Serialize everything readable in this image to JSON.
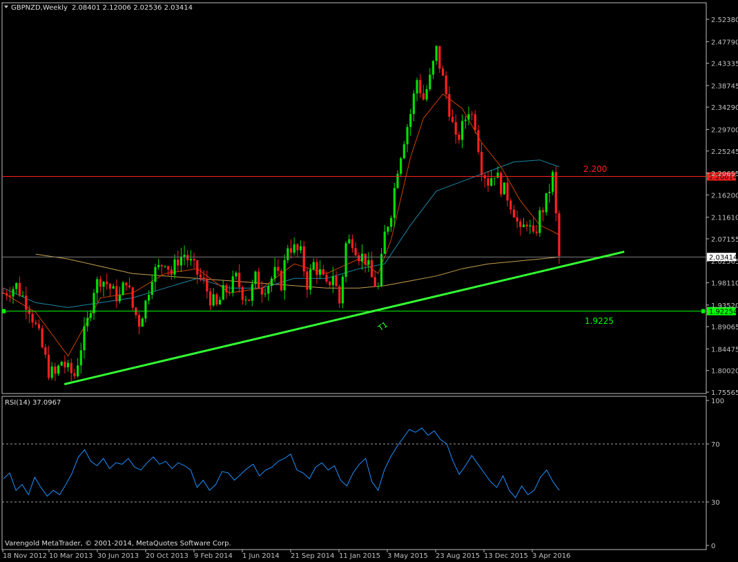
{
  "window": {
    "symbol_title": "GBPNZD,Weekly",
    "ohlc_readout": "2.08401 2.12006 2.02536 2.03414",
    "menu_icon": "triangle-down-icon",
    "copyright": "Varengold MetaTrader, © 2001-2014, MetaQuotes Software Corp."
  },
  "colors": {
    "background": "#000000",
    "bull": "#00e000",
    "bear": "#ff2020",
    "rsi": "#1e90ff",
    "ma_fast": "#cc4400",
    "ma_mid": "#1e88a8",
    "ma_slow": "#c8a050",
    "resistance": "#ff2020",
    "support": "#00ff00",
    "trendline": "#33ff33",
    "axis": "#c0c0c0"
  },
  "annotations": {
    "resistance_label": "2.200",
    "support_label": "1.9225",
    "trendline_label": "T1"
  },
  "chart_data": [
    {
      "type": "candlestick",
      "title": "GBPNZD,Weekly",
      "ylim": [
        1.75565,
        2.54
      ],
      "y_ticks": [
        "2.52380",
        "2.47790",
        "2.43335",
        "2.38745",
        "2.34290",
        "2.29700",
        "2.25245",
        "2.20655",
        "2.16200",
        "2.11610",
        "2.07155",
        "2.02565",
        "1.98110",
        "1.93520",
        "1.89065",
        "1.84475",
        "1.80020",
        "1.75565"
      ],
      "x_ticks": [
        "18 Nov 2012",
        "10 Mar 2013",
        "30 Jun 2013",
        "20 Oct 2013",
        "9 Feb 2014",
        "1 Jun 2014",
        "21 Sep 2014",
        "11 Jan 2015",
        "3 May 2015",
        "23 Aug 2015",
        "13 Dec 2015",
        "3 Apr 2016"
      ],
      "price_markers": [
        {
          "label": "2.20014",
          "value": 2.20014,
          "color": "#ff2020"
        },
        {
          "label": "2.03414",
          "value": 2.03414,
          "color": "#ffffff"
        },
        {
          "label": "1.92254",
          "value": 1.92254,
          "color": "#00ff00"
        }
      ],
      "horizontal_lines": [
        {
          "value": 2.20014,
          "color": "#ff2020",
          "label": "2.200"
        },
        {
          "value": 1.92254,
          "color": "#00ff00",
          "label": "1.9225"
        },
        {
          "value": 2.03414,
          "color": "#808080",
          "label": ""
        }
      ],
      "trendline": {
        "label": "T1",
        "start": {
          "week": 15,
          "price": 1.772
        },
        "end": {
          "week": 190,
          "price": 2.045
        }
      },
      "close_path": [
        [
          0,
          1.96
        ],
        [
          4,
          1.975
        ],
        [
          8,
          1.93
        ],
        [
          11,
          1.87
        ],
        [
          14,
          1.8
        ],
        [
          16,
          1.79
        ],
        [
          18,
          1.82
        ],
        [
          20,
          1.8
        ],
        [
          22,
          1.79
        ],
        [
          24,
          1.85
        ],
        [
          26,
          1.9
        ],
        [
          28,
          1.97
        ],
        [
          30,
          1.99
        ],
        [
          32,
          1.98
        ],
        [
          34,
          1.96
        ],
        [
          36,
          1.95
        ],
        [
          38,
          1.99
        ],
        [
          40,
          1.93
        ],
        [
          42,
          1.9
        ],
        [
          44,
          1.94
        ],
        [
          46,
          2.0
        ],
        [
          48,
          2.01
        ],
        [
          50,
          2.03
        ],
        [
          52,
          2.0
        ],
        [
          54,
          2.03
        ],
        [
          56,
          2.04
        ],
        [
          58,
          2.02
        ],
        [
          60,
          2.0
        ],
        [
          62,
          1.98
        ],
        [
          64,
          1.95
        ],
        [
          66,
          1.93
        ],
        [
          68,
          1.96
        ],
        [
          70,
          1.97
        ],
        [
          72,
          1.99
        ],
        [
          74,
          1.96
        ],
        [
          76,
          1.95
        ],
        [
          78,
          1.99
        ],
        [
          80,
          1.97
        ],
        [
          82,
          1.98
        ],
        [
          84,
          2.0
        ],
        [
          86,
          1.98
        ],
        [
          88,
          2.06
        ],
        [
          90,
          2.05
        ],
        [
          92,
          2.04
        ],
        [
          94,
          1.98
        ],
        [
          96,
          2.02
        ],
        [
          98,
          2.0
        ],
        [
          100,
          1.97
        ],
        [
          102,
          2.0
        ],
        [
          104,
          1.94
        ],
        [
          106,
          2.06
        ],
        [
          108,
          2.07
        ],
        [
          110,
          2.04
        ],
        [
          112,
          2.03
        ],
        [
          114,
          1.99
        ],
        [
          116,
          1.97
        ],
        [
          118,
          2.08
        ],
        [
          120,
          2.13
        ],
        [
          122,
          2.22
        ],
        [
          124,
          2.28
        ],
        [
          126,
          2.33
        ],
        [
          128,
          2.4
        ],
        [
          130,
          2.36
        ],
        [
          132,
          2.4
        ],
        [
          134,
          2.46
        ],
        [
          136,
          2.4
        ],
        [
          138,
          2.34
        ],
        [
          140,
          2.27
        ],
        [
          142,
          2.3
        ],
        [
          144,
          2.34
        ],
        [
          146,
          2.31
        ],
        [
          148,
          2.22
        ],
        [
          150,
          2.19
        ],
        [
          152,
          2.21
        ],
        [
          154,
          2.18
        ],
        [
          156,
          2.16
        ],
        [
          158,
          2.13
        ],
        [
          160,
          2.08
        ],
        [
          162,
          2.11
        ],
        [
          164,
          2.07
        ],
        [
          166,
          2.12
        ],
        [
          168,
          2.15
        ],
        [
          170,
          2.2
        ],
        [
          172,
          2.034
        ]
      ],
      "ma_fast_path": [
        [
          0,
          1.96
        ],
        [
          10,
          1.92
        ],
        [
          20,
          1.83
        ],
        [
          30,
          1.95
        ],
        [
          40,
          1.96
        ],
        [
          50,
          2.0
        ],
        [
          60,
          2.01
        ],
        [
          70,
          1.96
        ],
        [
          80,
          1.97
        ],
        [
          90,
          2.02
        ],
        [
          100,
          2.0
        ],
        [
          110,
          2.03
        ],
        [
          116,
          2.0
        ],
        [
          120,
          2.07
        ],
        [
          126,
          2.24
        ],
        [
          130,
          2.32
        ],
        [
          136,
          2.37
        ],
        [
          142,
          2.34
        ],
        [
          148,
          2.27
        ],
        [
          154,
          2.22
        ],
        [
          160,
          2.15
        ],
        [
          166,
          2.1
        ],
        [
          172,
          2.08
        ]
      ],
      "ma_mid_path": [
        [
          0,
          1.97
        ],
        [
          10,
          1.94
        ],
        [
          20,
          1.93
        ],
        [
          30,
          1.94
        ],
        [
          40,
          1.95
        ],
        [
          50,
          1.97
        ],
        [
          60,
          1.99
        ],
        [
          70,
          1.97
        ],
        [
          80,
          1.97
        ],
        [
          90,
          1.99
        ],
        [
          100,
          1.99
        ],
        [
          110,
          2.01
        ],
        [
          118,
          2.02
        ],
        [
          126,
          2.1
        ],
        [
          134,
          2.17
        ],
        [
          142,
          2.19
        ],
        [
          150,
          2.21
        ],
        [
          158,
          2.23
        ],
        [
          166,
          2.234
        ],
        [
          172,
          2.22
        ]
      ],
      "ma_slow_path": [
        [
          10,
          2.04
        ],
        [
          20,
          2.03
        ],
        [
          30,
          2.015
        ],
        [
          40,
          2.0
        ],
        [
          50,
          1.995
        ],
        [
          60,
          1.99
        ],
        [
          70,
          1.985
        ],
        [
          80,
          1.98
        ],
        [
          90,
          1.975
        ],
        [
          100,
          1.97
        ],
        [
          110,
          1.97
        ],
        [
          118,
          1.975
        ],
        [
          126,
          1.985
        ],
        [
          134,
          1.995
        ],
        [
          142,
          2.01
        ],
        [
          150,
          2.02
        ],
        [
          158,
          2.025
        ],
        [
          166,
          2.03
        ],
        [
          172,
          2.034
        ]
      ]
    },
    {
      "type": "line",
      "title": "RSI(14) 37.0967",
      "ylim": [
        0,
        100
      ],
      "y_ticks": [
        "100",
        "70",
        "30",
        "0"
      ],
      "levels": [
        70,
        30
      ],
      "series": [
        {
          "values": [
            46,
            50,
            38,
            42,
            35,
            47,
            40,
            34,
            38,
            35,
            42,
            50,
            61,
            66,
            58,
            55,
            60,
            53,
            57,
            56,
            60,
            54,
            52,
            57,
            61,
            56,
            58,
            53,
            57,
            55,
            52,
            40,
            45,
            38,
            42,
            51,
            50,
            45,
            49,
            53,
            56,
            48,
            52,
            54,
            58,
            60,
            63,
            52,
            50,
            46,
            54,
            57,
            52,
            55,
            45,
            41,
            50,
            56,
            60,
            44,
            38,
            52,
            61,
            68,
            74,
            80,
            78,
            81,
            76,
            79,
            73,
            70,
            58,
            49,
            55,
            62,
            56,
            50,
            44,
            40,
            48,
            38,
            33,
            41,
            35,
            38,
            47,
            52,
            44,
            38
          ]
        }
      ]
    }
  ]
}
